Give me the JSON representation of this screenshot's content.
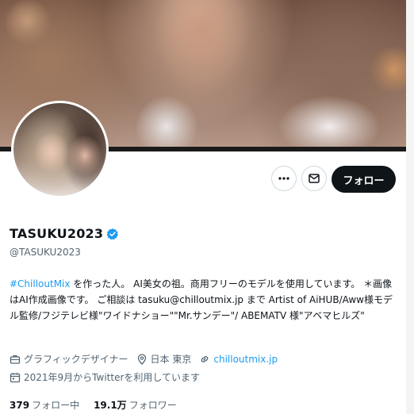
{
  "profile": {
    "name": "TASUKU2023",
    "handle": "@TASUKU2023",
    "follow_label": "フォロー",
    "bio": {
      "hashtag": "#ChilloutMix",
      "text": " を作った人。 AI美女の祖。商用フリーのモデルを使用しています。 ＊画像はAI作成画像です。 ご相談は tasuku@chilloutmix.jp まで Artist of AiHUB/Aww様モデル監修/フジテレビ様\"ワイドナショー\"\"Mr.サンデー\"/ ABEMATV 様\"アベマヒルズ\""
    },
    "category": "グラフィックデザイナー",
    "location": "日本 東京",
    "website": "chilloutmix.jp",
    "joined": "2021年9月からTwitterを利用しています",
    "following_count": "379",
    "following_label": "フォロー中",
    "followers_count": "19.1万",
    "followers_label": "フォロワー"
  },
  "icons": {
    "more": "more-icon",
    "message": "mail-icon",
    "verified": "verified-badge-icon",
    "category": "briefcase-icon",
    "location": "location-pin-icon",
    "link": "link-icon",
    "calendar": "calendar-icon"
  },
  "colors": {
    "accent": "#1d9bf0",
    "text": "#0f1419",
    "muted": "#536471",
    "button_bg": "#0f1419"
  }
}
